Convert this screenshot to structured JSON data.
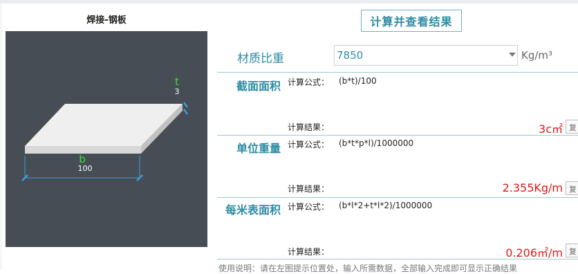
{
  "panel": {
    "title": "焊接-钢板"
  },
  "diagram": {
    "thickness_symbol": "t",
    "thickness_value": "3",
    "width_symbol": "b",
    "width_value": "100",
    "colors": {
      "background": "#474d55",
      "plate_top": "#efefef",
      "plate_front": "#d8d8d8",
      "plate_side": "#c2c2c2",
      "symbol": "#36e036",
      "dimension": "#3a9fd6"
    }
  },
  "calc_button": {
    "label": "计算并查看结果"
  },
  "density": {
    "label": "材质比重",
    "value": "7850",
    "unit": "Kg/m³"
  },
  "rows": [
    {
      "title": "截面面积",
      "formula_label": "计算公式：",
      "formula": "(b*t)/100",
      "result_label": "计算结果：",
      "result": "3c㎡",
      "copy_label": "复"
    },
    {
      "title": "单位重量",
      "formula_label": "计算公式：",
      "formula": "(b*t*p*l)/1000000",
      "result_label": "计算结果：",
      "result": "2.355Kg/m",
      "copy_label": "复"
    },
    {
      "title": "每米表面积",
      "formula_label": "计算公式：",
      "formula": "(b*l*2+t*l*2)/1000000",
      "result_label": "计算结果：",
      "result": "0.206㎡/m",
      "copy_label": "复"
    }
  ],
  "usage_note": "使用说明：请在左图提示位置处，输入所需数据，全部输入完成即可显示正确结果"
}
